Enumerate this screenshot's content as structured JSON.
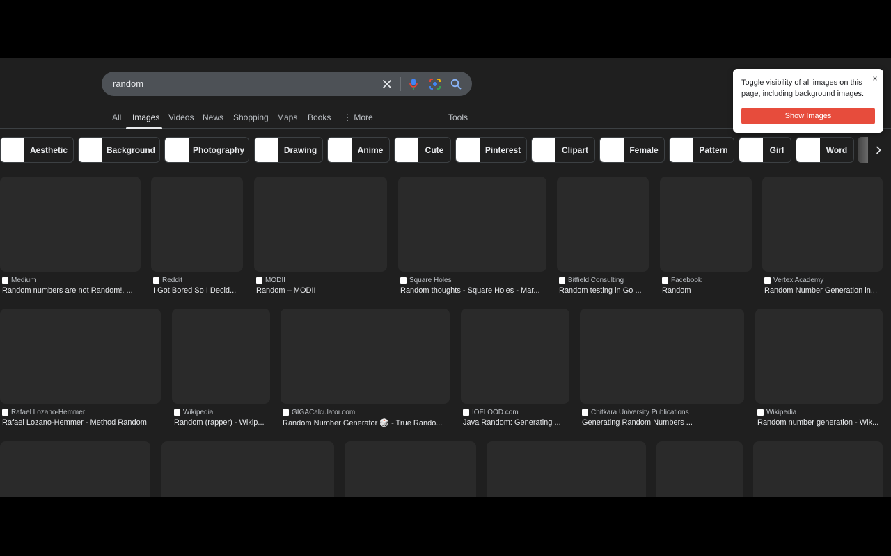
{
  "search": {
    "query": "random"
  },
  "tabs": [
    {
      "label": "All"
    },
    {
      "label": "Images"
    },
    {
      "label": "Videos"
    },
    {
      "label": "News"
    },
    {
      "label": "Shopping"
    },
    {
      "label": "Maps"
    },
    {
      "label": "Books"
    },
    {
      "label": "⋮ More"
    }
  ],
  "tools_label": "Tools",
  "active_tab": "Images",
  "chips": [
    {
      "label": "Aesthetic"
    },
    {
      "label": "Background"
    },
    {
      "label": "Photography"
    },
    {
      "label": "Drawing"
    },
    {
      "label": "Anime"
    },
    {
      "label": "Cute"
    },
    {
      "label": "Pinterest"
    },
    {
      "label": "Clipart"
    },
    {
      "label": "Female"
    },
    {
      "label": "Pattern"
    },
    {
      "label": "Girl"
    },
    {
      "label": "Word"
    }
  ],
  "results": {
    "row1": [
      {
        "source": "Medium",
        "title": "Random numbers are not Random!. ..."
      },
      {
        "source": "Reddit",
        "title": "I Got Bored So I Decid..."
      },
      {
        "source": "MODII",
        "title": "Random – MODII"
      },
      {
        "source": "Square Holes",
        "title": "Random thoughts - Square Holes - Mar..."
      },
      {
        "source": "Bitfield Consulting",
        "title": "Random testing in Go ..."
      },
      {
        "source": "Facebook",
        "title": "Random"
      },
      {
        "source": "Vertex Academy",
        "title": "Random Number Generation in..."
      }
    ],
    "row2": [
      {
        "source": "Rafael Lozano-Hemmer",
        "title": "Rafael Lozano-Hemmer - Method Random"
      },
      {
        "source": "Wikipedia",
        "title": "Random (rapper) - Wikip..."
      },
      {
        "source": "GIGACalculator.com",
        "title": "Random Number Generator 🎲 - True Rando..."
      },
      {
        "source": "IOFLOOD.com",
        "title": "Java Random: Generating ..."
      },
      {
        "source": "Chitkara University Publications",
        "title": "Generating Random Numbers ..."
      },
      {
        "source": "Wikipedia",
        "title": "Random number generation - Wik..."
      }
    ]
  },
  "popup": {
    "text": "Toggle visibility of all images on this page, including background images.",
    "button_label": "Show Images",
    "close_label": "×"
  },
  "colors": {
    "background": "#1f1f1f",
    "accent_button": "#e74c3c",
    "search_bar": "#4d5156"
  }
}
